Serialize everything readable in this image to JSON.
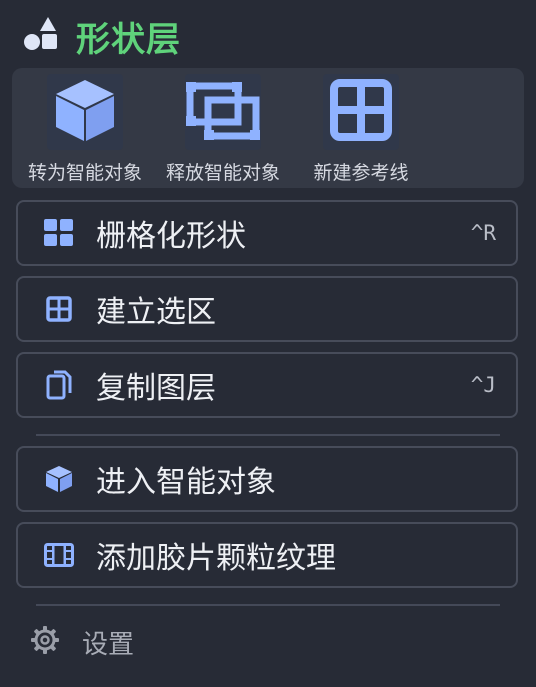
{
  "header": {
    "title": "形状层",
    "icon": "shapes-icon",
    "title_color": "#5fd37b"
  },
  "quick_actions": [
    {
      "label": "转为智能对象",
      "icon": "cube-icon"
    },
    {
      "label": "释放智能对象",
      "icon": "release-icon"
    },
    {
      "label": "新建参考线",
      "icon": "grid-icon"
    }
  ],
  "menu": {
    "items": [
      {
        "label": "栅格化形状",
        "icon": "rasterize-icon",
        "shortcut": "^R"
      },
      {
        "label": "建立选区",
        "icon": "selection-grid-icon",
        "shortcut": ""
      },
      {
        "label": "复制图层",
        "icon": "copy-icon",
        "shortcut": "^J"
      },
      {
        "label": "进入智能对象",
        "icon": "cube-icon",
        "shortcut": ""
      },
      {
        "label": "添加胶片颗粒纹理",
        "icon": "film-icon",
        "shortcut": ""
      }
    ]
  },
  "settings": {
    "label": "设置",
    "icon": "gear-icon"
  },
  "colors": {
    "accent": "#8fb2ff",
    "background": "#272b36",
    "panel": "#343945",
    "border": "#474c5a"
  }
}
